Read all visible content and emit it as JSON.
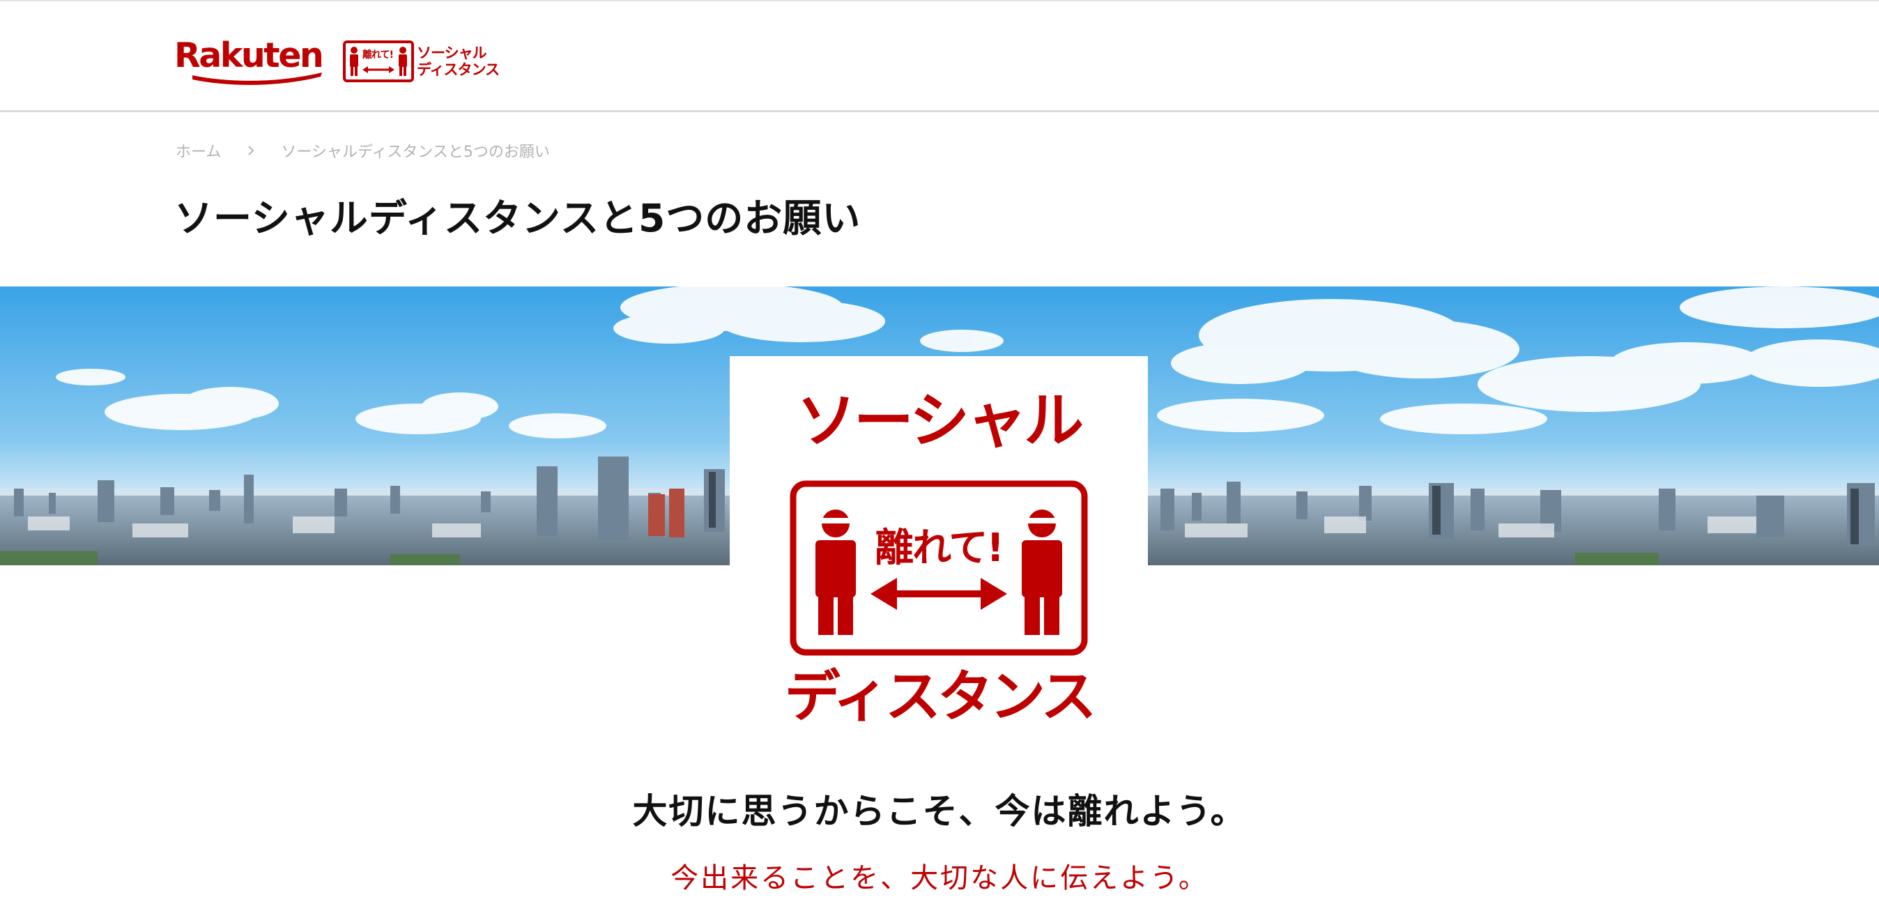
{
  "header": {
    "brand": "Rakuten",
    "campaign_logo": {
      "badge_text": "離れて!",
      "line1": "ソーシャル",
      "line2": "ディスタンス"
    }
  },
  "breadcrumb": {
    "items": [
      {
        "label": "ホーム"
      },
      {
        "label": "ソーシャルディスタンスと5つのお願い"
      }
    ]
  },
  "page": {
    "title": "ソーシャルディスタンスと5つのお願い"
  },
  "hero": {
    "logo": {
      "top_text": "ソーシャル",
      "center_text": "離れて!",
      "bottom_text": "ディスタンス"
    }
  },
  "messages": {
    "main": "大切に思うからこそ、今は離れよう。",
    "sub": "今出来ることを、大切な人に伝えよう。"
  },
  "colors": {
    "brand_red": "#bf0000",
    "text_dark": "#111111",
    "breadcrumb_gray": "#b3b3b3",
    "sky_blue": "#5fb6ea"
  }
}
